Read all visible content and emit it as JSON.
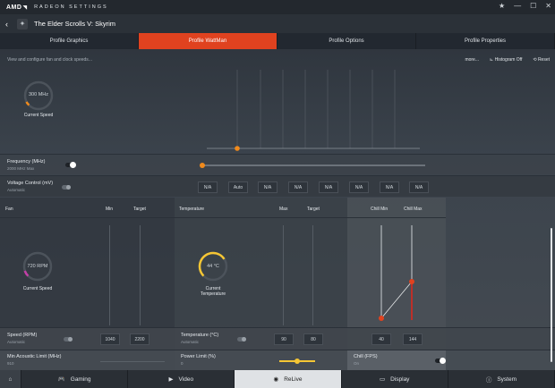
{
  "window": {
    "brand": "AMD",
    "brand_mark": "◥",
    "app_name": "RADEON SETTINGS",
    "controls": [
      "★",
      "—",
      "☐",
      "✕"
    ]
  },
  "game": {
    "back_icon": "‹",
    "icon": "dragon-icon",
    "title": "The Elder Scrolls V: Skyrim"
  },
  "tabs": [
    {
      "label": "Profile Graphics",
      "active": false
    },
    {
      "label": "Profile WattMan",
      "active": true
    },
    {
      "label": "Profile Options",
      "active": false
    },
    {
      "label": "Profile Properties",
      "active": false
    }
  ],
  "options": {
    "description": "View and configure fan and clock speeds...",
    "more": "more...",
    "histogram": "Histogram Off",
    "reset": "Reset"
  },
  "gpu": {
    "gauge_value": "300 MHz",
    "gauge_label": "Current Speed",
    "frequency_label": "Frequency (MHz)",
    "frequency_sub": "2000 MHz Max",
    "voltage_label": "Voltage Control (mV)",
    "voltage_sub": "Automatic",
    "state_values": [
      "N/A",
      "Auto",
      "N/A",
      "N/A",
      "N/A",
      "N/A",
      "N/A",
      "N/A"
    ]
  },
  "fan": {
    "header": "Fan",
    "min_header": "Min",
    "target_header": "Target",
    "gauge_value": "720 RPM",
    "gauge_label": "Current Speed",
    "speed_label": "Speed (RPM)",
    "speed_sub": "Automatic",
    "min_value": "1040",
    "target_value": "2200",
    "acoustic_label": "Min Acoustic Limit (MHz)",
    "acoustic_sub": "910"
  },
  "temperature": {
    "header": "Temperature",
    "max_header": "Max",
    "target_header": "Target",
    "gauge_value": "44 °C",
    "gauge_label": "Current Temperature",
    "temp_label": "Temperature (°C)",
    "temp_sub": "Automatic",
    "max_value": "90",
    "target_value": "80",
    "power_label": "Power Limit (%)",
    "power_sub": "0"
  },
  "chill": {
    "min_header": "Chill Min",
    "max_header": "Chill Max",
    "min_value": "40",
    "max_value": "144",
    "fps_label": "Chill (FPS)",
    "fps_sub": "On"
  },
  "nav": [
    {
      "label": "",
      "icon": "home-icon"
    },
    {
      "label": "Gaming",
      "icon": "gamepad-icon"
    },
    {
      "label": "Video",
      "icon": "play-icon"
    },
    {
      "label": "ReLive",
      "icon": "record-icon",
      "active": true
    },
    {
      "label": "Display",
      "icon": "monitor-icon"
    },
    {
      "label": "System",
      "icon": "info-icon"
    }
  ],
  "colors": {
    "accent": "#e0421f",
    "fan_gauge": "#c23fa6",
    "temp_gauge": "#f5c634",
    "slider": "#f08a1c"
  }
}
